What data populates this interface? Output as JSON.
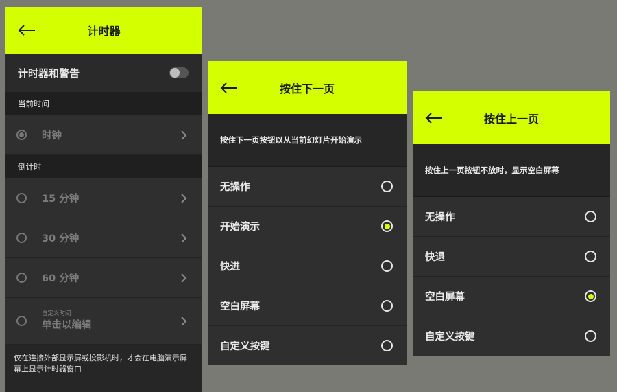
{
  "colors": {
    "accent": "#d4ff00",
    "panel_bg": "#2a2a2a",
    "background": "#7a7a74"
  },
  "timer_panel": {
    "back_icon": "arrow-left-icon",
    "title": "计时器",
    "toggle_label": "计时器和警告",
    "toggle_on": false,
    "current_time_section": "当前时间",
    "clock_label": "时钟",
    "countdown_section": "倒计时",
    "countdown_items": [
      "15 分钟",
      "30 分钟",
      "60 分钟"
    ],
    "custom_small_label": "自定义时间",
    "custom_main_label": "单击以编辑",
    "footnote": "仅在连接外部显示屏或投影机时，才会在电脑演示屏幕上显示计时器窗口"
  },
  "hold_next_panel": {
    "back_icon": "arrow-left-icon",
    "title": "按住下一页",
    "description": "按住下一页按钮以从当前幻灯片开始演示",
    "options": [
      {
        "label": "无操作",
        "checked": false
      },
      {
        "label": "开始演示",
        "checked": true
      },
      {
        "label": "快进",
        "checked": false
      },
      {
        "label": "空白屏幕",
        "checked": false
      },
      {
        "label": "自定义按键",
        "checked": false
      }
    ]
  },
  "hold_prev_panel": {
    "back_icon": "arrow-left-icon",
    "title": "按住上一页",
    "description": "按住上一页按钮不放时，显示空白屏幕",
    "options": [
      {
        "label": "无操作",
        "checked": false
      },
      {
        "label": "快退",
        "checked": false
      },
      {
        "label": "空白屏幕",
        "checked": true
      },
      {
        "label": "自定义按键",
        "checked": false
      }
    ]
  }
}
